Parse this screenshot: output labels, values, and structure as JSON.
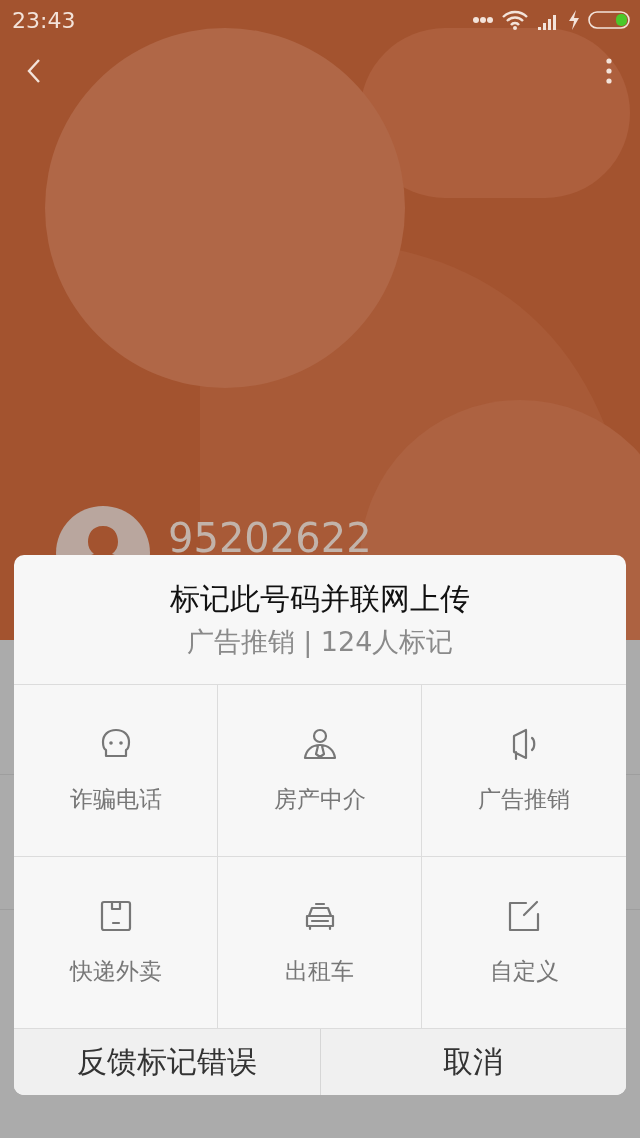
{
  "status_bar": {
    "time": "23:43"
  },
  "contact": {
    "number": "95202622"
  },
  "dialog": {
    "title": "标记此号码并联网上传",
    "subtitle": "广告推销 | 124人标记",
    "options": [
      {
        "kind": "fraud",
        "label": "诈骗电话"
      },
      {
        "kind": "agent",
        "label": "房产中介"
      },
      {
        "kind": "ad",
        "label": "广告推销"
      },
      {
        "kind": "delivery",
        "label": "快递外卖"
      },
      {
        "kind": "taxi",
        "label": "出租车"
      },
      {
        "kind": "custom",
        "label": "自定义"
      }
    ],
    "buttons": [
      "反馈标记错误",
      "取消"
    ]
  }
}
